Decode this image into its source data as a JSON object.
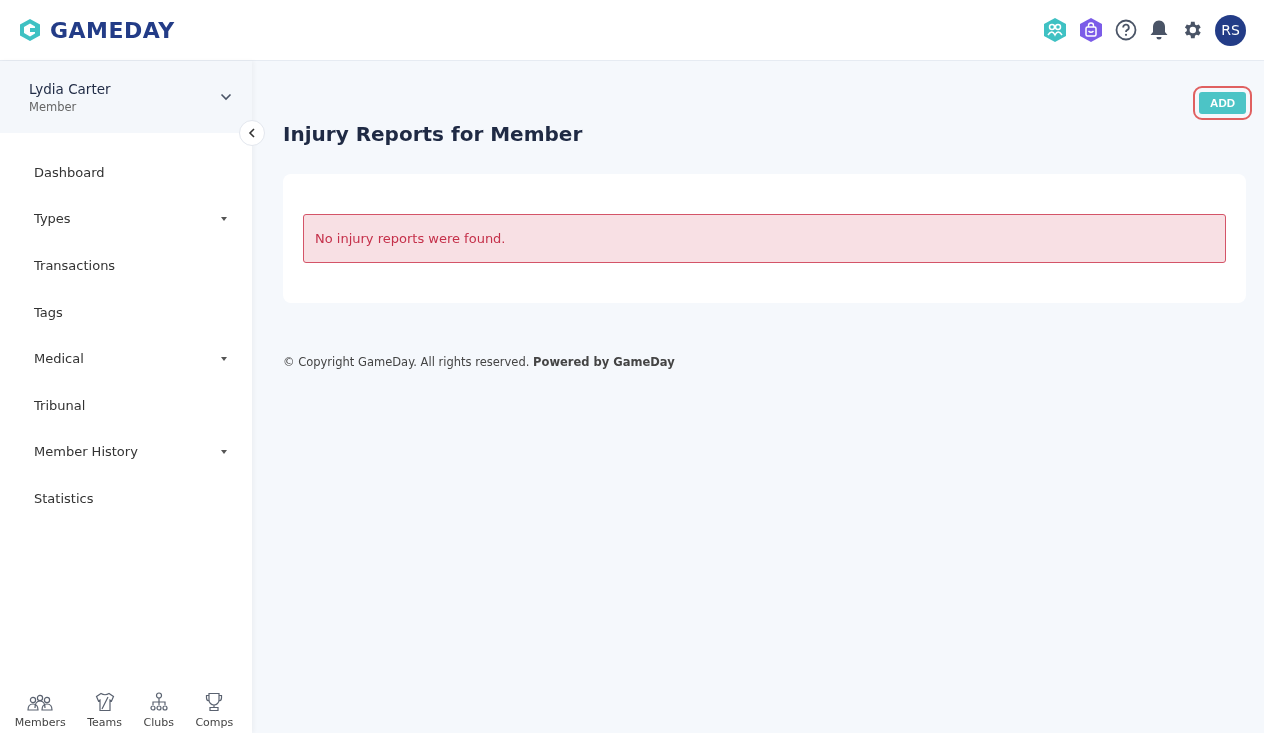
{
  "header": {
    "logo": "GAMEDAY",
    "avatar": "RS"
  },
  "user": {
    "name": "Lydia Carter",
    "role": "Member"
  },
  "sidebar": {
    "items": [
      {
        "label": "Dashboard",
        "expandable": false
      },
      {
        "label": "Types",
        "expandable": true
      },
      {
        "label": "Transactions",
        "expandable": false
      },
      {
        "label": "Tags",
        "expandable": false
      },
      {
        "label": "Medical",
        "expandable": true
      },
      {
        "label": "Tribunal",
        "expandable": false
      },
      {
        "label": "Member History",
        "expandable": true
      },
      {
        "label": "Statistics",
        "expandable": false
      }
    ],
    "bottom_nav": [
      {
        "label": "Members",
        "kind": "members"
      },
      {
        "label": "Teams",
        "kind": "teams"
      },
      {
        "label": "Clubs",
        "kind": "clubs"
      },
      {
        "label": "Comps",
        "kind": "comps"
      }
    ]
  },
  "page": {
    "title": "Injury Reports for Member",
    "add_button": "ADD",
    "alert": "No injury reports were found.",
    "footer": "© Copyright GameDay. All rights reserved. **Powered by GameDay**"
  }
}
